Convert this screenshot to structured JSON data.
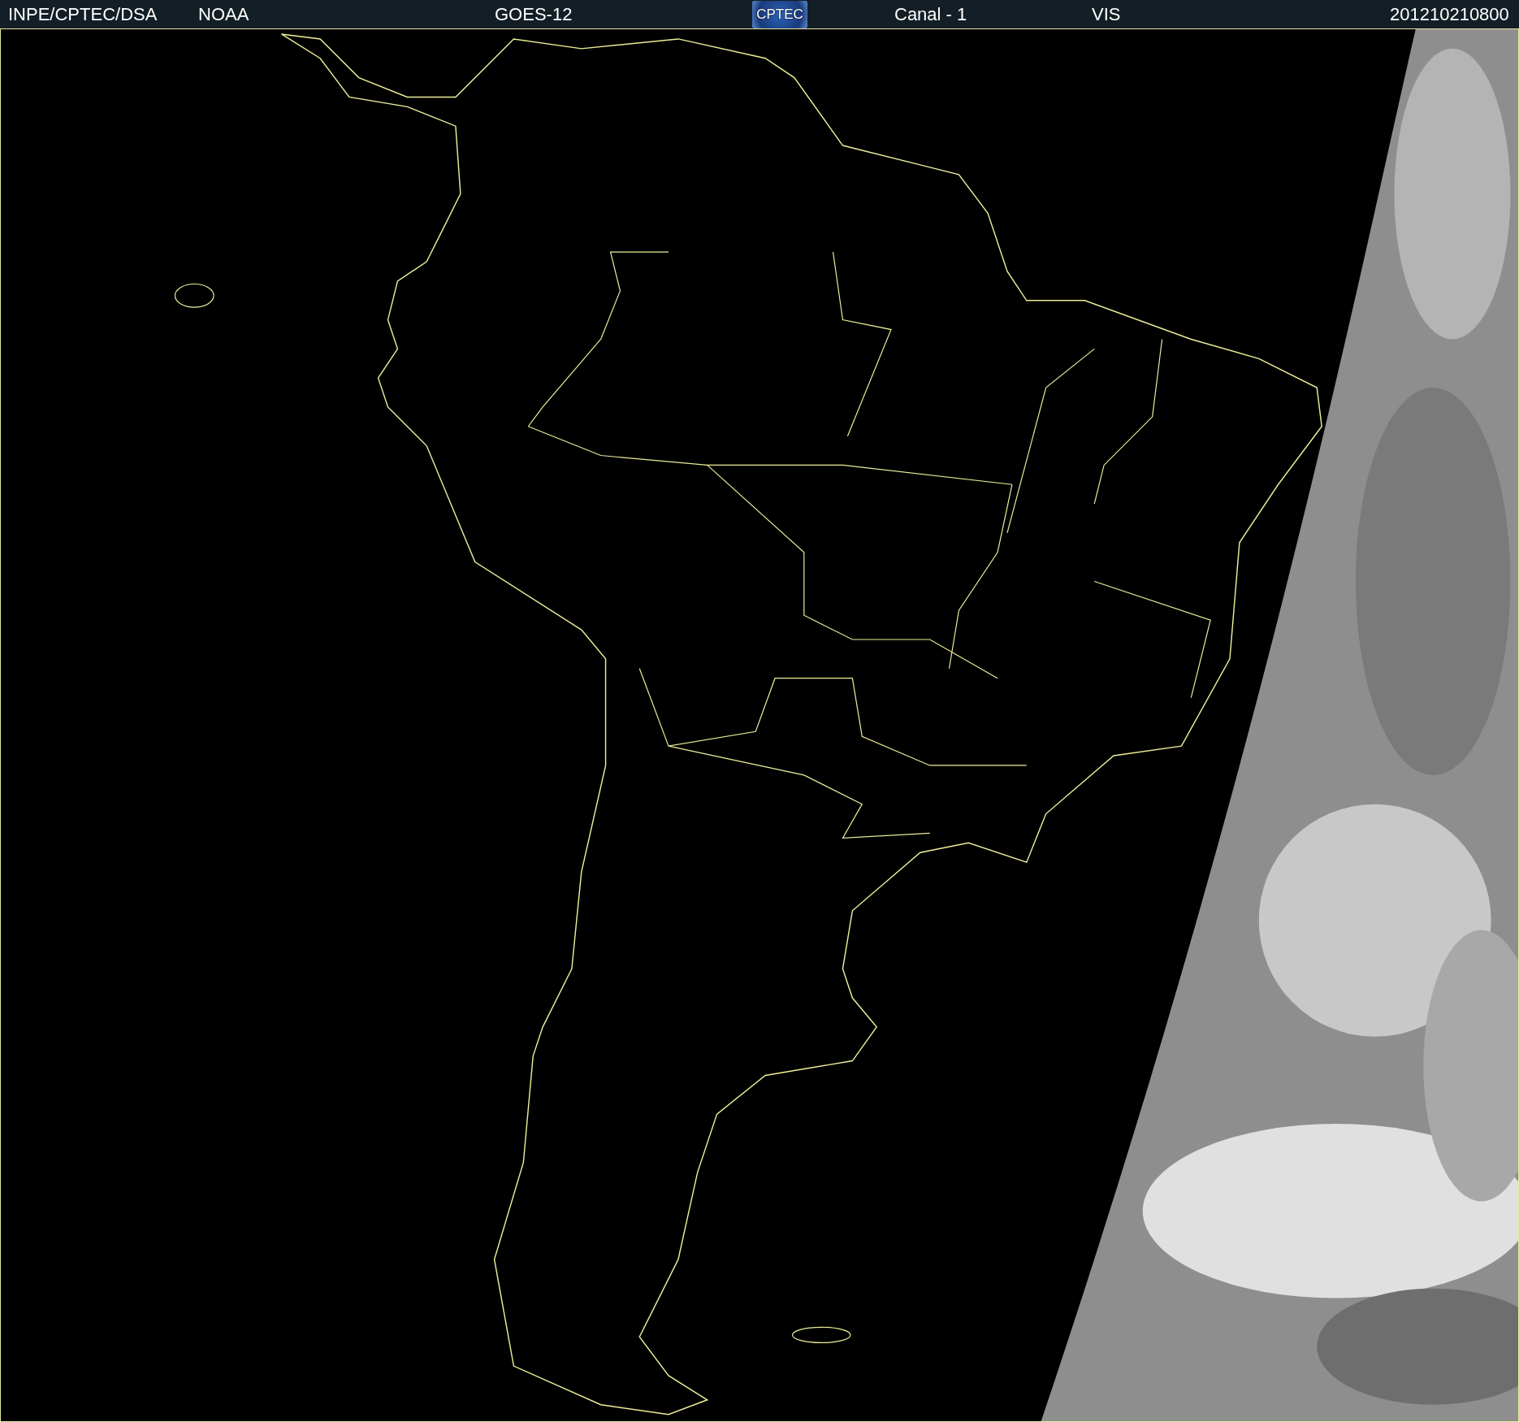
{
  "header": {
    "items": [
      {
        "kind": "text",
        "text": "INPE/CPTEC/DSA"
      },
      {
        "kind": "text",
        "text": "NOAA"
      },
      {
        "kind": "text",
        "text": "GOES-12"
      },
      {
        "kind": "logo",
        "text": "CPTEC"
      },
      {
        "kind": "text",
        "text": "Canal - 1"
      },
      {
        "kind": "text",
        "text": "VIS"
      },
      {
        "kind": "text",
        "text": "201210210800"
      }
    ]
  }
}
